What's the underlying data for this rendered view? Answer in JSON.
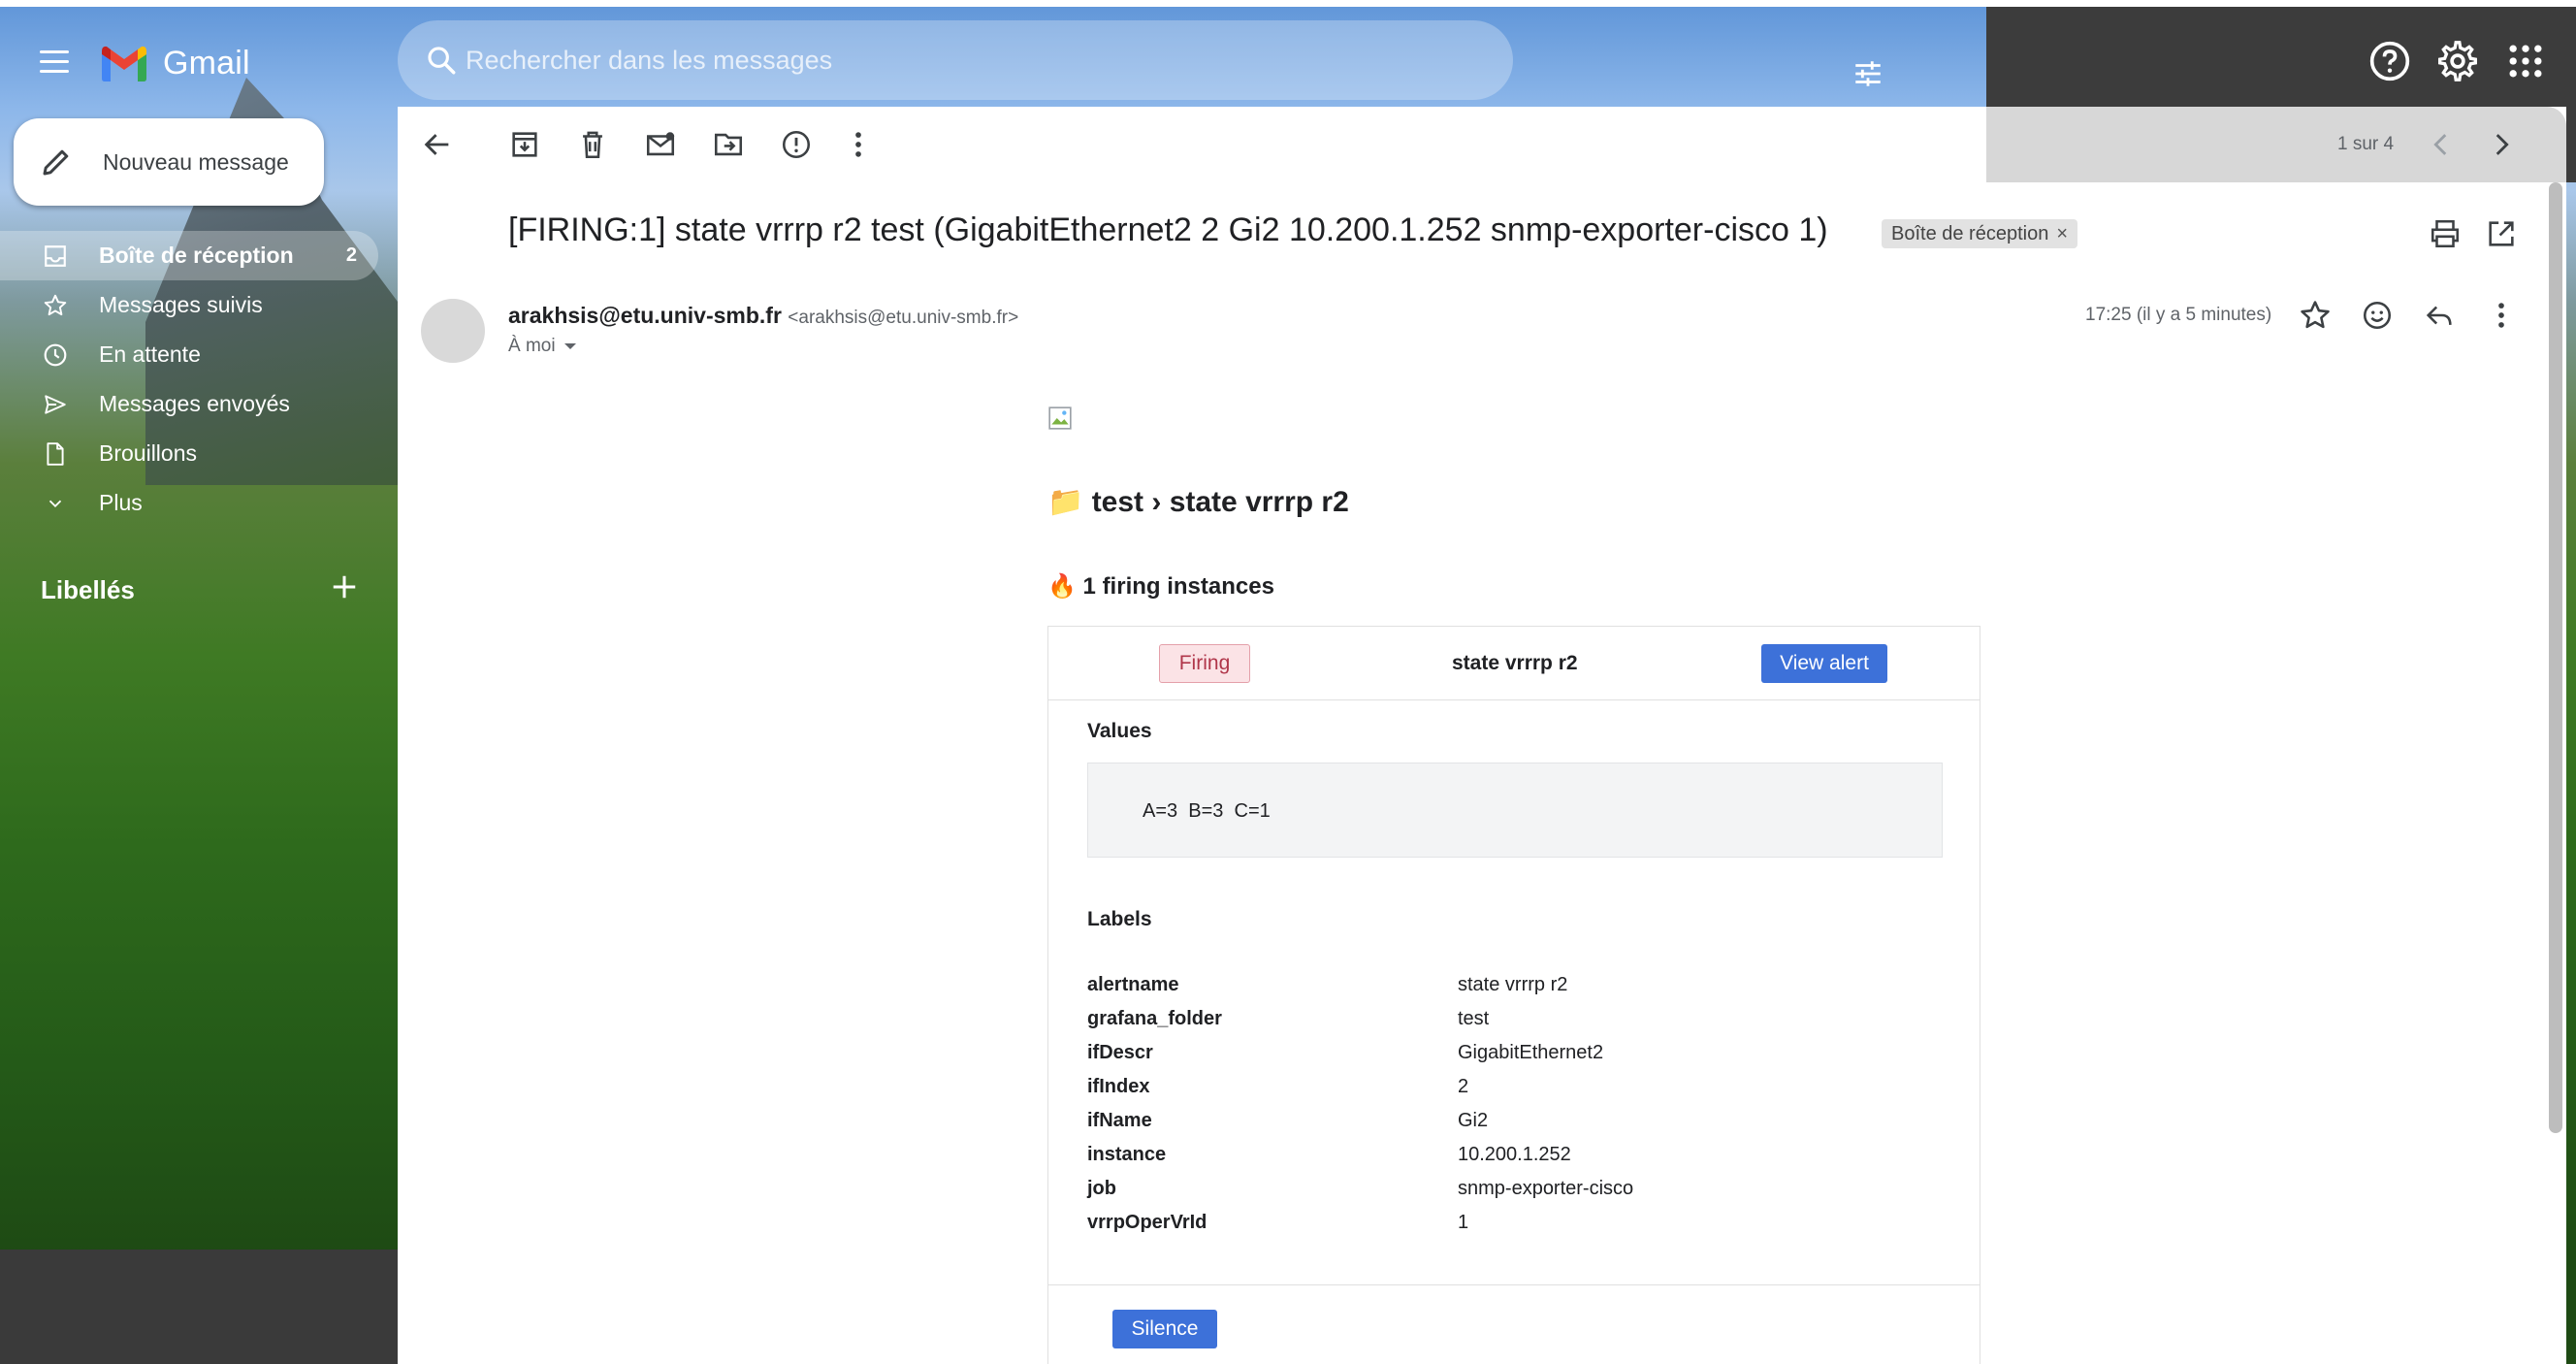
{
  "app": {
    "name": "Gmail"
  },
  "search": {
    "placeholder": "Rechercher dans les messages"
  },
  "compose": {
    "label": "Nouveau message"
  },
  "sidebar": {
    "items": [
      {
        "label": "Boîte de réception",
        "count": "2",
        "icon": "inbox-icon"
      },
      {
        "label": "Messages suivis",
        "icon": "star-icon"
      },
      {
        "label": "En attente",
        "icon": "clock-icon"
      },
      {
        "label": "Messages envoyés",
        "icon": "send-icon"
      },
      {
        "label": "Brouillons",
        "icon": "draft-icon"
      },
      {
        "label": "Plus",
        "icon": "chevron-down-icon"
      }
    ],
    "labels_title": "Libellés"
  },
  "toolbar": {
    "pager": "1 sur 4"
  },
  "message": {
    "subject": "[FIRING:1] state vrrrp r2 test (GigabitEthernet2 2 Gi2 10.200.1.252 snmp-exporter-cisco 1)",
    "label_chip": "Boîte de réception",
    "sender_name": "arakhsis@etu.univ-smb.fr",
    "sender_addr": "<arakhsis@etu.univ-smb.fr>",
    "to": "À moi",
    "date": "17:25 (il y a 5 minutes)"
  },
  "alert": {
    "folder_title": "📁 test › state vrrrp r2",
    "firing_count": "🔥 1 firing instances",
    "status_badge": "Firing",
    "title": "state vrrrp r2",
    "view_button": "View alert",
    "values_heading": "Values",
    "values": "A=3  B=3  C=1",
    "labels_heading": "Labels",
    "labels": [
      {
        "key": "alertname",
        "value": "state vrrrp r2"
      },
      {
        "key": "grafana_folder",
        "value": "test"
      },
      {
        "key": "ifDescr",
        "value": "GigabitEthernet2"
      },
      {
        "key": "ifIndex",
        "value": "2"
      },
      {
        "key": "ifName",
        "value": "Gi2"
      },
      {
        "key": "instance",
        "value": "10.200.1.252"
      },
      {
        "key": "job",
        "value": "snmp-exporter-cisco"
      },
      {
        "key": "vrrpOperVrId",
        "value": "1"
      }
    ],
    "silence_button": "Silence"
  }
}
